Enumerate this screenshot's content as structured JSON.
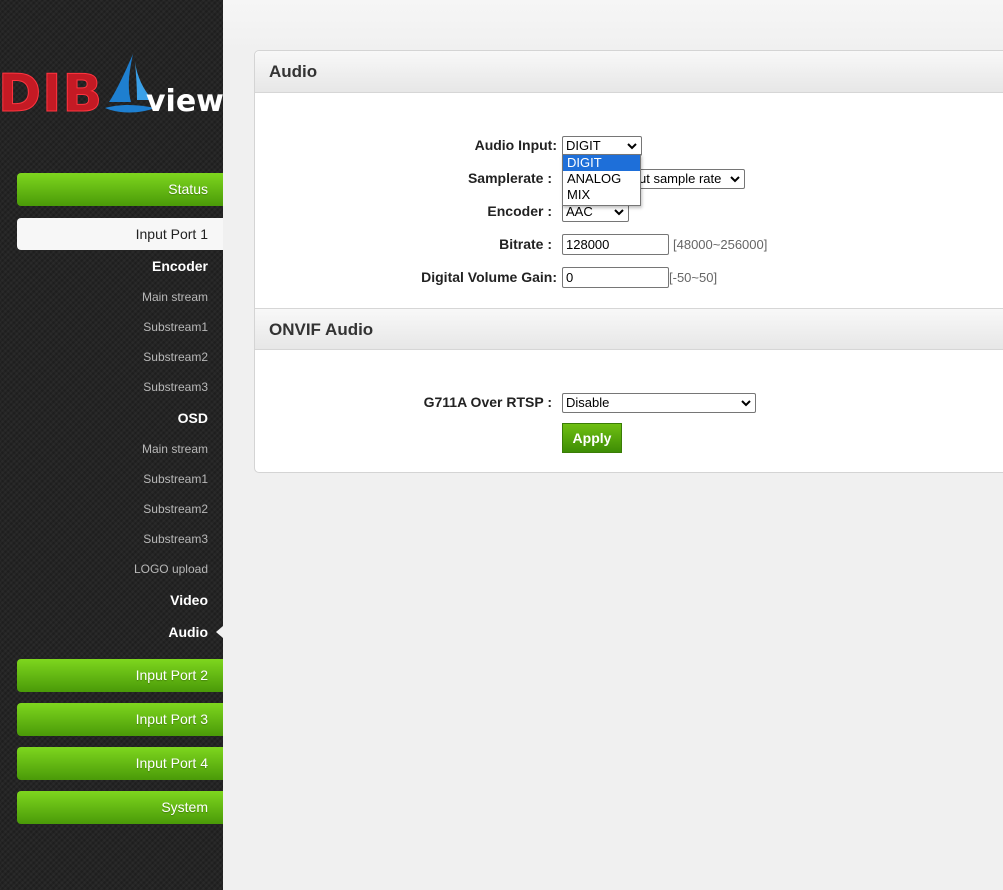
{
  "logo": {
    "brand": "DIB",
    "sub": "view"
  },
  "sidebar": {
    "status": "Status",
    "input_port_1": "Input Port 1",
    "encoder": "Encoder",
    "encoder_items": [
      "Main stream",
      "Substream1",
      "Substream2",
      "Substream3"
    ],
    "osd": "OSD",
    "osd_items": [
      "Main stream",
      "Substream1",
      "Substream2",
      "Substream3",
      "LOGO upload"
    ],
    "video": "Video",
    "audio": "Audio",
    "input_port_2": "Input Port 2",
    "input_port_3": "Input Port 3",
    "input_port_4": "Input Port 4",
    "system": "System"
  },
  "audio_section": {
    "title": "Audio",
    "audio_input_label": "Audio Input:",
    "audio_input_value": "DIGIT",
    "audio_input_options": [
      "DIGIT",
      "ANALOG",
      "MIX"
    ],
    "samplerate_label": "Samplerate :",
    "samplerate_value": "ut sample rate",
    "encoder_label": "Encoder :",
    "encoder_value": "AAC",
    "bitrate_label": "Bitrate :",
    "bitrate_value": "128000",
    "bitrate_hint": "[48000~256000]",
    "gain_label": "Digital Volume Gain:",
    "gain_value": "0",
    "gain_hint": "[-50~50]"
  },
  "onvif_section": {
    "title": "ONVIF Audio",
    "g711_label": "G711A Over RTSP :",
    "g711_value": "Disable",
    "apply_label": "Apply"
  },
  "colors": {
    "accent_green": "#5fb012",
    "logo_red": "#c41a24",
    "logo_blue": "#1e7fd0",
    "selection_blue": "#1e6fd9"
  }
}
